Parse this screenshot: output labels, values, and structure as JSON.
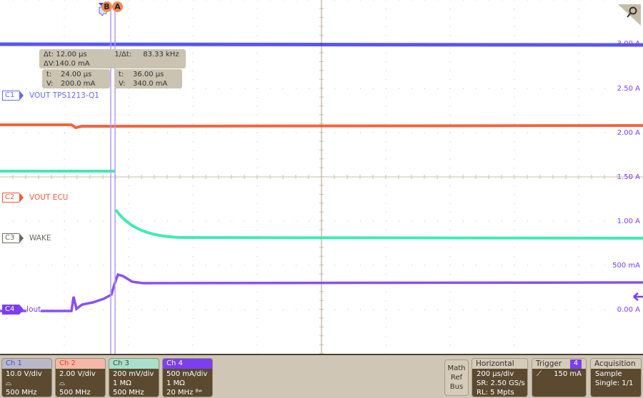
{
  "waveform_area": {
    "channels": [
      {
        "id": "C1",
        "name": "VOUT TPS1213-Q1",
        "color": "#3a3af0",
        "tag_color": "#6a6ae8"
      },
      {
        "id": "C2",
        "name": "VOUT ECU",
        "color": "#f04a20",
        "tag_color": "#f05a3a"
      },
      {
        "id": "C3",
        "name": "WAKE",
        "color": "#1ee8a8",
        "tag_color": "#6b6b5b"
      },
      {
        "id": "C4",
        "name": "Iout",
        "color": "#7b3ef0",
        "tag_color": "#7b3ef0"
      }
    ],
    "scale_labels": [
      "3.00 A",
      "2.50 A",
      "2.00 A",
      "1.50 A",
      "1.00 A",
      "500 mA",
      "0.00 A"
    ],
    "cursors": {
      "b_label": "B",
      "a_label": "A"
    },
    "readout_delta": {
      "dt_label": "Δt:",
      "dt_value": "12.00 µs",
      "inv_dt_label": "1/Δt:",
      "inv_dt_value": "83.33 kHz",
      "dv_label": "ΔV:",
      "dv_value": "140.0 mA"
    },
    "readout_cursor_b": {
      "t_label": "t:",
      "t_value": "24.00 µs",
      "v_label": "V:",
      "v_value": "200.0 mA"
    },
    "readout_cursor_a": {
      "t_label": "t:",
      "t_value": "36.00 µs",
      "v_label": "V:",
      "v_value": "340.0 mA"
    }
  },
  "channel_boxes": [
    {
      "title": "Ch 1",
      "line1": "10.0 V/div",
      "line2": "⌓",
      "line3": "500 MHz",
      "header_bg": "#b8b8c8",
      "header_fg": "#4a4ae0"
    },
    {
      "title": "Ch 2",
      "line1": "2.00 V/div",
      "line2": "⌓",
      "line3": "500 MHz",
      "header_bg": "#f4b8a8",
      "header_fg": "#e8401c"
    },
    {
      "title": "Ch 3",
      "line1": "200 mV/div",
      "line2": "1 MΩ",
      "line3": "500 MHz",
      "header_bg": "#a8e0cc",
      "header_fg": "#3a4a3a"
    },
    {
      "title": "Ch 4",
      "line1": "500 mA/div",
      "line2": "1 MΩ",
      "line3": "20 MHz ᴮʷ",
      "header_bg": "#7b3ef0",
      "header_fg": "#ffffff"
    }
  ],
  "math_ref_bus": {
    "line1": "Math",
    "line2": "Ref",
    "line3": "Bus"
  },
  "horizontal": {
    "title": "Horizontal",
    "scale": "200 µs/div",
    "sample_rate": "SR: 2.50 GS/s",
    "record_length": "RL: 5 Mpts"
  },
  "trigger": {
    "title": "Trigger",
    "source": "4",
    "slope": "⟋",
    "level": "150 mA"
  },
  "acquisition": {
    "title": "Acquisition",
    "mode": "Sample",
    "state": "Single: 1/1"
  }
}
